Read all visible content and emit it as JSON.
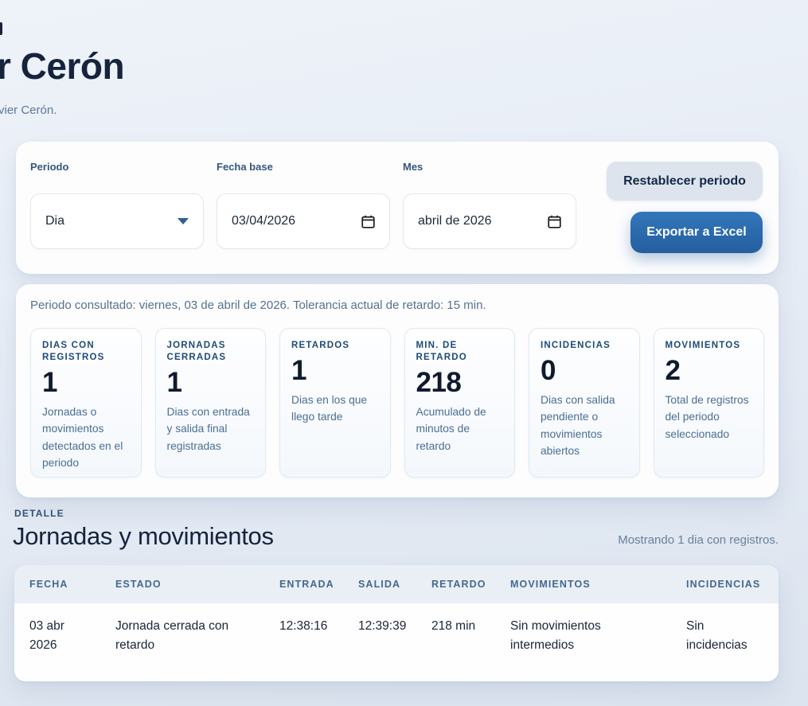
{
  "header": {
    "title_visible": "r Cerón",
    "subtitle_visible": "vier Cerón."
  },
  "filters": {
    "periodo": {
      "label": "Periodo",
      "value": "Dia"
    },
    "fecha_base": {
      "label": "Fecha base",
      "value": "03/04/2026"
    },
    "mes": {
      "label": "Mes",
      "value": "abril de 2026"
    },
    "reset_label": "Restablecer periodo",
    "export_label": "Exportar a Excel"
  },
  "summary": {
    "period_text": "Periodo consultado: viernes, 03 de abril de 2026. Tolerancia actual de retardo: 15 min.",
    "cards": [
      {
        "label": "DIAS CON REGISTROS",
        "value": "1",
        "description": "Jornadas o movimientos detectados en el periodo"
      },
      {
        "label": "JORNADAS CERRADAS",
        "value": "1",
        "description": "Dias con entrada y salida final registradas"
      },
      {
        "label": "RETARDOS",
        "value": "1",
        "description": "Dias en los que llego tarde"
      },
      {
        "label": "MIN. DE RETARDO",
        "value": "218",
        "description": "Acumulado de minutos de retardo"
      },
      {
        "label": "INCIDENCIAS",
        "value": "0",
        "description": "Dias con salida pendiente o movimientos abiertos"
      },
      {
        "label": "MOVIMIENTOS",
        "value": "2",
        "description": "Total de registros del periodo seleccionado"
      }
    ]
  },
  "detail": {
    "eyebrow": "DETALLE",
    "title": "Jornadas y movimientos",
    "count_text": "Mostrando 1 dia con registros.",
    "table": {
      "headers": [
        "FECHA",
        "ESTADO",
        "ENTRADA",
        "SALIDA",
        "RETARDO",
        "MOVIMIENTOS",
        "INCIDENCIAS"
      ],
      "rows": [
        [
          "03 abr 2026",
          "Jornada cerrada con retardo",
          "12:38:16",
          "12:39:39",
          "218 min",
          "Sin movimientos intermedios",
          "Sin incidencias"
        ]
      ]
    }
  },
  "colors": {
    "accent_blue": "#2b6cb0",
    "dark_navy": "#16233d",
    "muted_blue": "#4a6e92",
    "header_row_bg": "#eaeff6",
    "reset_button_bg": "#dde4ee"
  }
}
